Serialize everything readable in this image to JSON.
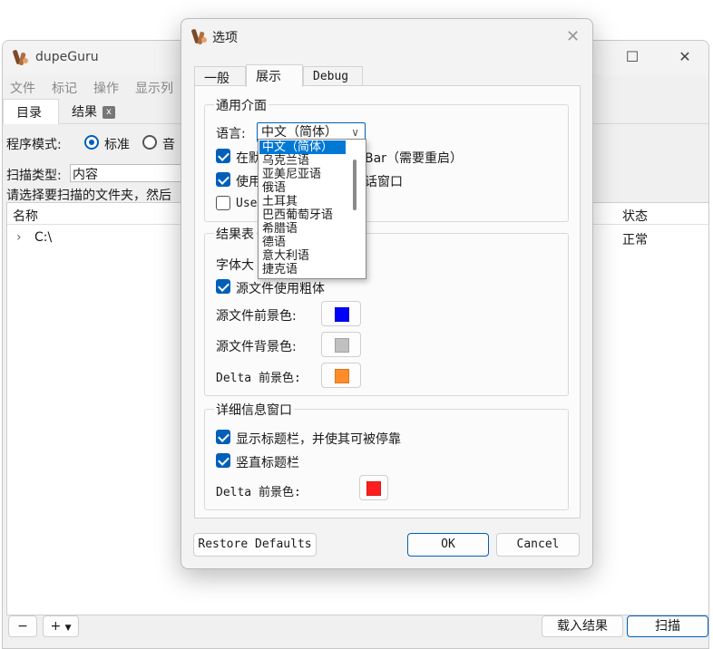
{
  "main": {
    "title": "dupeGuru",
    "menu": [
      "文件",
      "标记",
      "操作",
      "显示列"
    ],
    "tabs": [
      {
        "label": "目录"
      },
      {
        "label": "结果",
        "close": "x"
      }
    ],
    "program_mode_label": "程序模式:",
    "mode_standard": "标准",
    "mode_music_partial": "音",
    "scan_type_label": "扫描类型:",
    "scan_type_value": "内容",
    "hint": "请选择要扫描的文件夹，然后",
    "tree_headers": {
      "name": "名称",
      "state": "状态"
    },
    "tree_rows": [
      {
        "path": "C:\\",
        "state": "正常"
      }
    ],
    "bottom": {
      "remove": "−",
      "add": "+",
      "load_results": "载入结果",
      "scan": "扫描"
    }
  },
  "dialog": {
    "title": "选项",
    "tabs": [
      {
        "label": "一般"
      },
      {
        "label": "展示"
      },
      {
        "label": "Debug"
      }
    ],
    "general_group": {
      "title": "通用介面",
      "language_label": "语言:",
      "language_value": "中文（简体）",
      "language_options": [
        "中文（简体）",
        "乌克兰语",
        "亚美尼亚语",
        "俄语",
        "土耳其",
        "巴西葡萄牙语",
        "希腊语",
        "德语",
        "意大利语",
        "捷克语"
      ],
      "cb1_label_prefix": "在默",
      "cb1_label_suffix": "Bar（需要重启）",
      "cb2_label_prefix": "使用",
      "cb2_label_suffix": "话窗口",
      "cb3_label_prefix": "Use"
    },
    "result_group": {
      "title_partial": "结果表",
      "font_size_partial": "字体大",
      "bold_label": "源文件使用粗体",
      "fg_label": "源文件前景色:",
      "bg_label": "源文件背景色:",
      "delta_label": "Delta 前景色:",
      "fg_color": "#0000ff",
      "bg_color": "#c0c0c0",
      "delta_color": "#ff8c28"
    },
    "detail_group": {
      "title": "详细信息窗口",
      "show_titlebar_label": "显示标题栏，并使其可被停靠",
      "vertical_titlebar_label": "竖直标题栏",
      "delta_label": "Delta 前景色:",
      "delta_color": "#ff1e1e"
    },
    "restore_defaults": "Restore Defaults",
    "ok": "OK",
    "cancel": "Cancel"
  }
}
